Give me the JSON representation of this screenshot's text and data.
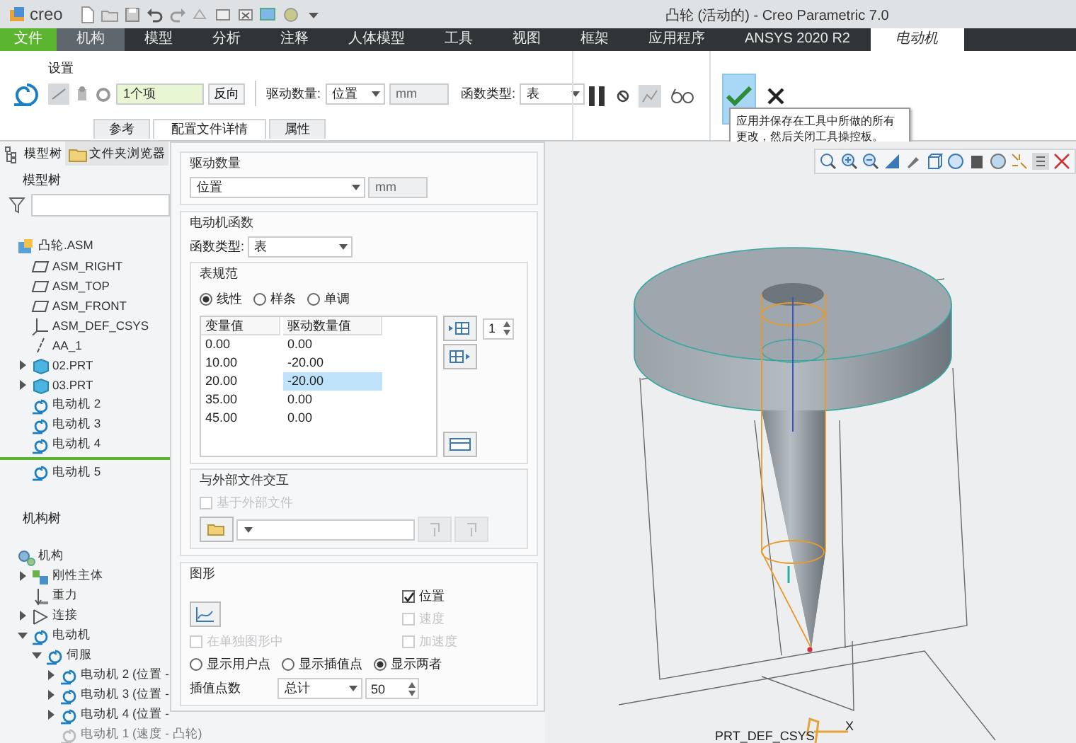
{
  "window": {
    "logo": "creo",
    "title": "凸轮 (活动的) - Creo Parametric 7.0"
  },
  "ribbon_tabs": [
    {
      "label": "文件",
      "kind": "file",
      "selected": false
    },
    {
      "label": "机构",
      "kind": "app",
      "selected": false
    },
    {
      "label": "模型",
      "kind": "normal",
      "selected": false
    },
    {
      "label": "分析",
      "kind": "normal",
      "selected": false
    },
    {
      "label": "注释",
      "kind": "normal",
      "selected": false
    },
    {
      "label": "人体模型",
      "kind": "normal",
      "selected": false
    },
    {
      "label": "工具",
      "kind": "normal",
      "selected": false
    },
    {
      "label": "视图",
      "kind": "normal",
      "selected": false
    },
    {
      "label": "框架",
      "kind": "normal",
      "selected": false
    },
    {
      "label": "应用程序",
      "kind": "normal",
      "selected": false
    },
    {
      "label": "ANSYS 2020 R2",
      "kind": "normal",
      "selected": false
    },
    {
      "label": "电动机",
      "kind": "normal",
      "selected": true
    }
  ],
  "ribbon": {
    "group_label": "设置",
    "reference_field": {
      "value": "1个项"
    },
    "reverse_button": "反向",
    "drive_quantity": {
      "label": "驱动数量:",
      "value": "位置",
      "unit": "mm"
    },
    "function_type": {
      "label": "函数类型:",
      "value": "表"
    },
    "tooltip": "应用并保存在工具中所做的所有更改，然后关闭工具操控板。"
  },
  "dashboard_tabs": [
    {
      "label": "参考",
      "selected": false
    },
    {
      "label": "配置文件详情",
      "selected": true
    },
    {
      "label": "属性",
      "selected": false
    }
  ],
  "tree_tabs": [
    {
      "label": "模型树",
      "kind": "tree",
      "selected": true
    },
    {
      "label": "文件夹浏览器",
      "kind": "folder",
      "selected": false
    }
  ],
  "model_tree": {
    "header": "模型树",
    "items": [
      {
        "label": "凸轮.ASM",
        "kind": "asm",
        "children": [
          {
            "label": "ASM_RIGHT",
            "kind": "plane"
          },
          {
            "label": "ASM_TOP",
            "kind": "plane"
          },
          {
            "label": "ASM_FRONT",
            "kind": "plane"
          },
          {
            "label": "ASM_DEF_CSYS",
            "kind": "csys"
          },
          {
            "label": "AA_1",
            "kind": "axis"
          },
          {
            "label": "02.PRT",
            "kind": "part",
            "expanded": false
          },
          {
            "label": "03.PRT",
            "kind": "part",
            "expanded": false
          },
          {
            "label": "电动机 2",
            "kind": "motor"
          },
          {
            "label": "电动机 3",
            "kind": "motor"
          },
          {
            "label": "电动机 4",
            "kind": "motor"
          },
          {
            "label": "电动机 5",
            "kind": "motor",
            "insert_here": true
          }
        ]
      }
    ]
  },
  "mechanism_tree": {
    "header": "机构树",
    "items": [
      {
        "label": "机构",
        "kind": "mech",
        "children": [
          {
            "label": "刚性主体",
            "kind": "body",
            "expanded": false
          },
          {
            "label": "重力",
            "kind": "gravity"
          },
          {
            "label": "连接",
            "kind": "joint",
            "expanded": false
          },
          {
            "label": "电动机",
            "kind": "motor",
            "expanded": true,
            "children": [
              {
                "label": "伺服",
                "kind": "motor",
                "expanded": true,
                "children": [
                  {
                    "label": "电动机 2 (位置 -",
                    "kind": "motor",
                    "expanded": false
                  },
                  {
                    "label": "电动机 3 (位置 -",
                    "kind": "motor",
                    "expanded": false
                  },
                  {
                    "label": "电动机 4 (位置 -",
                    "kind": "motor",
                    "expanded": false
                  },
                  {
                    "label": "电动机 1 (速度 - 凸轮)",
                    "kind": "motor-off"
                  }
                ]
              }
            ]
          }
        ]
      }
    ]
  },
  "panel": {
    "drive_group": {
      "title": "驱动数量",
      "value": "位置",
      "unit": "mm"
    },
    "function_group": {
      "title": "电动机函数",
      "type_label": "函数类型:",
      "type_value": "表",
      "table_spec": {
        "title": "表规范",
        "interpolation": [
          {
            "label": "线性",
            "selected": true
          },
          {
            "label": "样条",
            "selected": false
          },
          {
            "label": "单调",
            "selected": false
          }
        ],
        "columns": [
          "变量值",
          "驱动数量值"
        ],
        "rows": [
          {
            "cells": [
              {
                "text": "0.00",
                "selected": false
              },
              {
                "text": "0.00",
                "selected": false
              }
            ]
          },
          {
            "cells": [
              {
                "text": "10.00",
                "selected": false
              },
              {
                "text": "-20.00",
                "selected": false
              }
            ]
          },
          {
            "cells": [
              {
                "text": "20.00",
                "selected": false
              },
              {
                "text": "-20.00",
                "selected": true
              }
            ]
          },
          {
            "cells": [
              {
                "text": "35.00",
                "selected": false
              },
              {
                "text": "0.00",
                "selected": false
              }
            ]
          },
          {
            "cells": [
              {
                "text": "45.00",
                "selected": false
              },
              {
                "text": "0.00",
                "selected": false
              }
            ]
          }
        ],
        "row_count": "1"
      },
      "external": {
        "title": "与外部文件交互",
        "checkbox": {
          "label": "基于外部文件",
          "checked": false,
          "disabled": true
        }
      }
    },
    "graph_group": {
      "title": "图形",
      "plots": [
        {
          "label": "位置",
          "checked": true,
          "disabled": false
        },
        {
          "label": "速度",
          "checked": false,
          "disabled": true
        },
        {
          "label": "加速度",
          "checked": false,
          "disabled": true
        }
      ],
      "separate": {
        "label": "在单独图形中",
        "checked": false,
        "disabled": true
      },
      "display": [
        {
          "label": "显示用户点",
          "selected": false
        },
        {
          "label": "显示插值点",
          "selected": false
        },
        {
          "label": "显示两者",
          "selected": true
        }
      ],
      "points_label": "插值点数",
      "points_mode": "总计",
      "points_value": "50"
    }
  },
  "viewport": {
    "csys_label": "PRT_DEF_CSYS",
    "axis_label": "X"
  }
}
